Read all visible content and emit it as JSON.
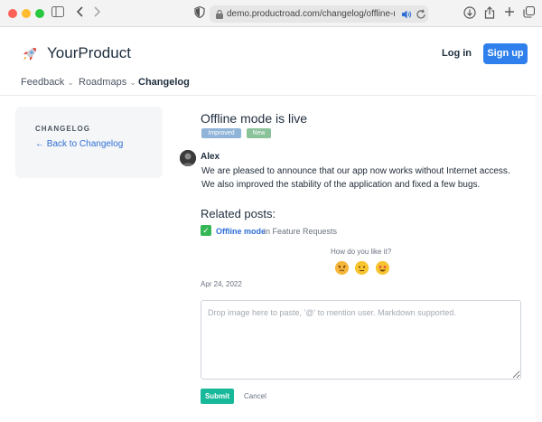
{
  "browser": {
    "url": "demo.productroad.com/changelog/offline-mode-is-"
  },
  "header": {
    "brand": "YourProduct",
    "login_label": "Log in",
    "signup_label": "Sign up",
    "nav": [
      {
        "label": "Feedback",
        "has_dropdown": true
      },
      {
        "label": "Roadmaps",
        "has_dropdown": true
      },
      {
        "label": "Changelog",
        "has_dropdown": false,
        "active": true
      }
    ]
  },
  "sidebar": {
    "kicker": "CHANGELOG",
    "back_label": "← Back to Changelog"
  },
  "post": {
    "title": "Offline mode is live",
    "tags": [
      {
        "label": "Improved",
        "color": "#8fb4d8"
      },
      {
        "label": "New",
        "color": "#8ac29a"
      }
    ],
    "author": "Alex",
    "body": [
      "We are pleased to announce that our app now works without Internet access.",
      "We also improved the stability of the application and fixed a few bugs."
    ],
    "related_heading": "Related posts:",
    "related": {
      "title": "Offline mode",
      "context": "in Feature Requests"
    },
    "reaction_prompt": "How do you like it?",
    "reactions": [
      "angry-face",
      "neutral-face",
      "star-struck-face"
    ],
    "date": "Apr 24, 2022"
  },
  "comment": {
    "placeholder": "Drop image here to paste, '@' to mention user. Markdown supported.",
    "submit_label": "Submit",
    "cancel_label": "Cancel"
  },
  "colors": {
    "accent": "#2f80ed",
    "link": "#2f6fd6",
    "submit": "#18b89a"
  }
}
